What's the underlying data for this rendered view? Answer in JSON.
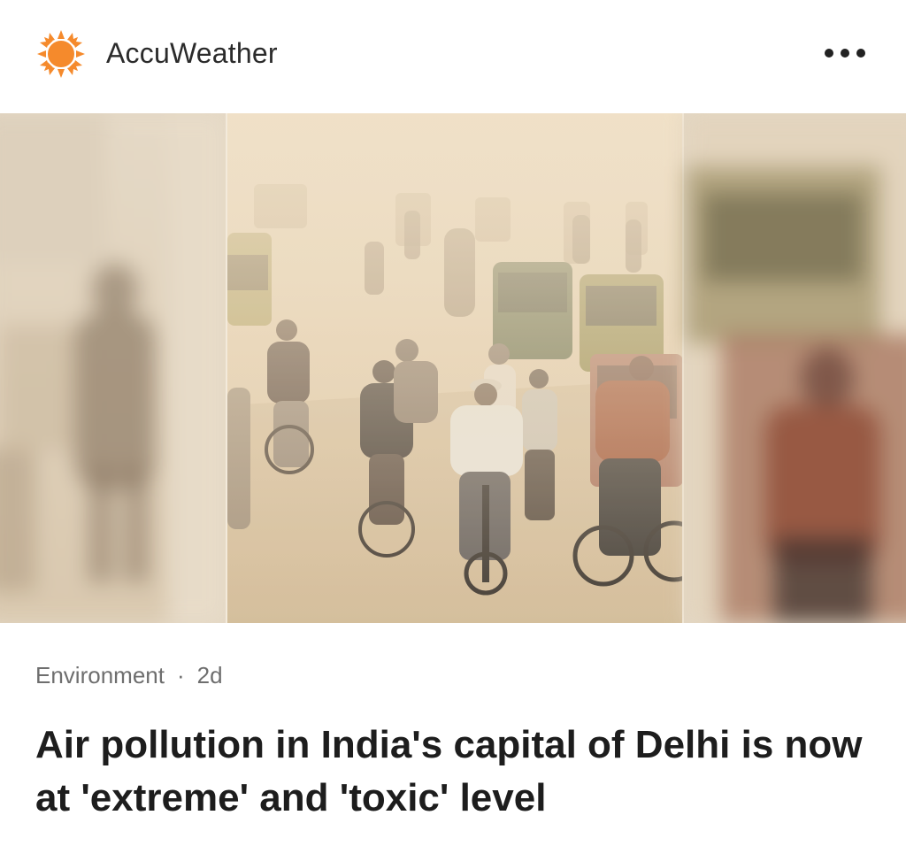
{
  "header": {
    "source_name": "AccuWeather",
    "logo_icon": "sun-icon",
    "logo_color": "#f58a2c",
    "more_icon": "more-horizontal-icon"
  },
  "article": {
    "category": "Environment",
    "separator": "·",
    "age": "2d",
    "headline": "Air pollution in India's capital of Delhi is now at 'extreme' and 'toxic' level",
    "image_alt": "Cyclists and auto-rickshaws on a smog-filled road in Delhi"
  }
}
